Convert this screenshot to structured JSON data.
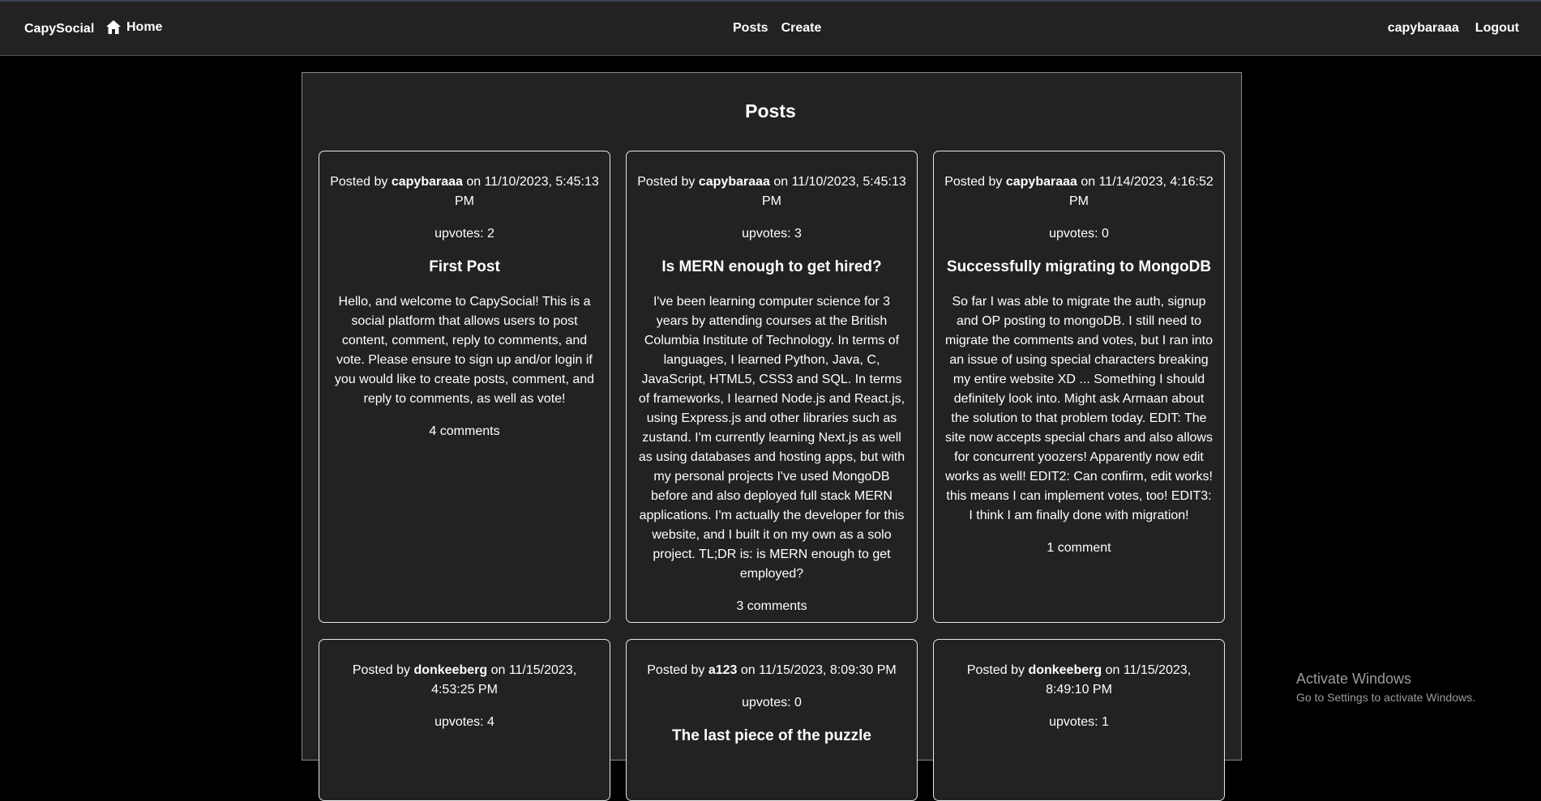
{
  "nav": {
    "brand": "CapySocial",
    "home_label": "Home",
    "center": [
      "Posts",
      "Create"
    ],
    "username": "capybaraaa",
    "logout": "Logout"
  },
  "main": {
    "title": "Posts",
    "posts": [
      {
        "prefix": "Posted by ",
        "author": "capybaraaa",
        "date_text": " on 11/10/2023, 5:45:13 PM",
        "upvotes": "upvotes: 2",
        "title": "First Post",
        "body": "Hello, and welcome to CapySocial! This is a social platform that allows users to post content, comment, reply to comments, and vote. Please ensure to sign up and/or login if you would like to create posts, comment, and reply to comments, as well as vote!",
        "comments": "4 comments"
      },
      {
        "prefix": "Posted by ",
        "author": "capybaraaa",
        "date_text": " on 11/10/2023, 5:45:13 PM",
        "upvotes": "upvotes: 3",
        "title": "Is MERN enough to get hired?",
        "body": "I've been learning computer science for 3 years by attending courses at the British Columbia Institute of Technology. In terms of languages, I learned Python, Java, C, JavaScript, HTML5, CSS3 and SQL. In terms of frameworks, I learned Node.js and React.js, using Express.js and other libraries such as zustand. I'm currently learning Next.js as well as using databases and hosting apps, but with my personal projects I've used MongoDB before and also deployed full stack MERN applications. I'm actually the developer for this website, and I built it on my own as a solo project. TL;DR is: is MERN enough to get employed?",
        "comments": "3 comments"
      },
      {
        "prefix": "Posted by ",
        "author": "capybaraaa",
        "date_text": " on 11/14/2023, 4:16:52 PM",
        "upvotes": "upvotes: 0",
        "title": "Successfully migrating to MongoDB",
        "body": "So far I was able to migrate the auth, signup and OP posting to mongoDB. I still need to migrate the comments and votes, but I ran into an issue of using special characters breaking my entire website XD ... Something I should definitely look into. Might ask Armaan about the solution to that problem today. EDIT: The site now accepts special chars and also allows for concurrent yoozers! Apparently now edit works as well! EDIT2: Can confirm, edit works! this means I can implement votes, too! EDIT3: I think I am finally done with migration!",
        "comments": "1 comment"
      },
      {
        "prefix": "Posted by ",
        "author": "donkeeberg",
        "date_text": " on 11/15/2023, 4:53:25 PM",
        "upvotes": "upvotes: 4",
        "title": "",
        "body": "",
        "comments": ""
      },
      {
        "prefix": "Posted by ",
        "author": "a123",
        "date_text": " on 11/15/2023, 8:09:30 PM",
        "upvotes": "upvotes: 0",
        "title": "The last piece of the puzzle",
        "body": "",
        "comments": ""
      },
      {
        "prefix": "Posted by ",
        "author": "donkeeberg",
        "date_text": " on 11/15/2023, 8:49:10 PM",
        "upvotes": "upvotes: 1",
        "title": "",
        "body": "",
        "comments": ""
      }
    ]
  },
  "watermark": {
    "line1": "Activate Windows",
    "line2": "Go to Settings to activate Windows."
  },
  "icons": {
    "home": "home-icon"
  }
}
